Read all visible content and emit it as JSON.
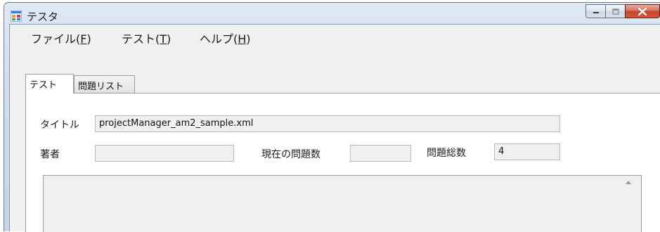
{
  "window": {
    "title": "テスタ",
    "icon": "app-window-icon"
  },
  "menu": {
    "items": [
      {
        "label": "ファイル(",
        "key": "F",
        "end": ")"
      },
      {
        "label": "テスト(",
        "key": "T",
        "end": ")"
      },
      {
        "label": "ヘルプ(",
        "key": "H",
        "end": ")"
      }
    ]
  },
  "tabs": [
    {
      "label": "テスト",
      "active": true
    },
    {
      "label": "問題リスト",
      "active": false
    }
  ],
  "form": {
    "title_label": "タイトル",
    "title_value": "projectManager_am2_sample.xml",
    "author_label": "著者",
    "author_value": "",
    "current_label": "現在の問題数",
    "current_value": "",
    "total_label": "問題総数",
    "total_value": "4"
  },
  "colors": {
    "close_button": "#c4442c",
    "field_bg": "#f0f0f0"
  }
}
